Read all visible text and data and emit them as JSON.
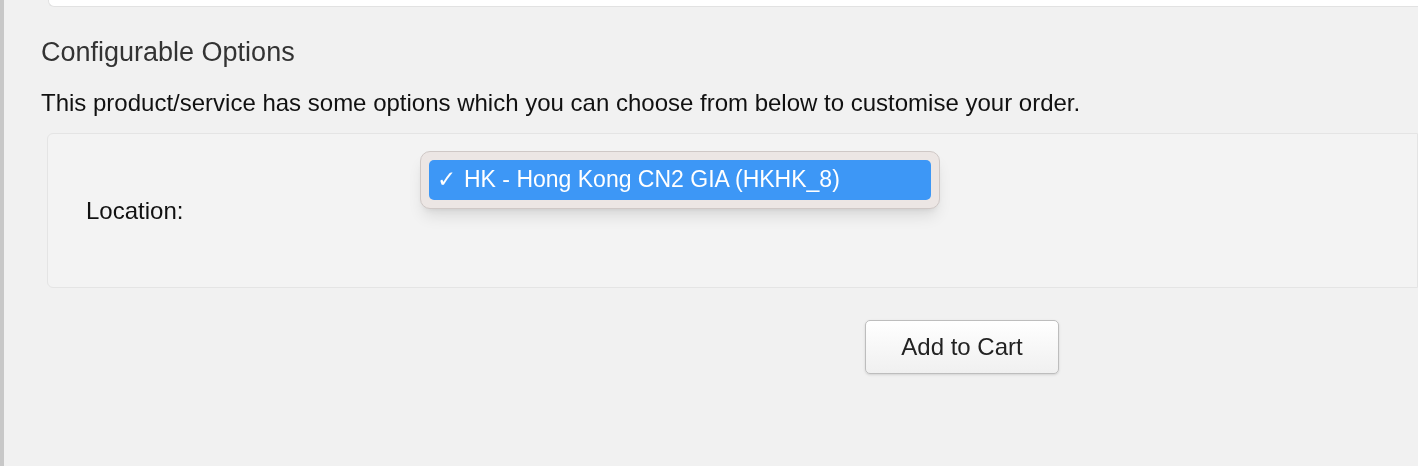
{
  "section": {
    "title": "Configurable Options",
    "description": "This product/service has some options which you can choose from below to customise your order."
  },
  "options": [
    {
      "label": "Location:",
      "dropdown": {
        "expanded": true,
        "items": [
          {
            "check": "✓",
            "label": "HK - Hong Kong CN2 GIA (HKHK_8)",
            "selected": true
          }
        ]
      }
    }
  ],
  "add_to_cart": "Add to Cart"
}
